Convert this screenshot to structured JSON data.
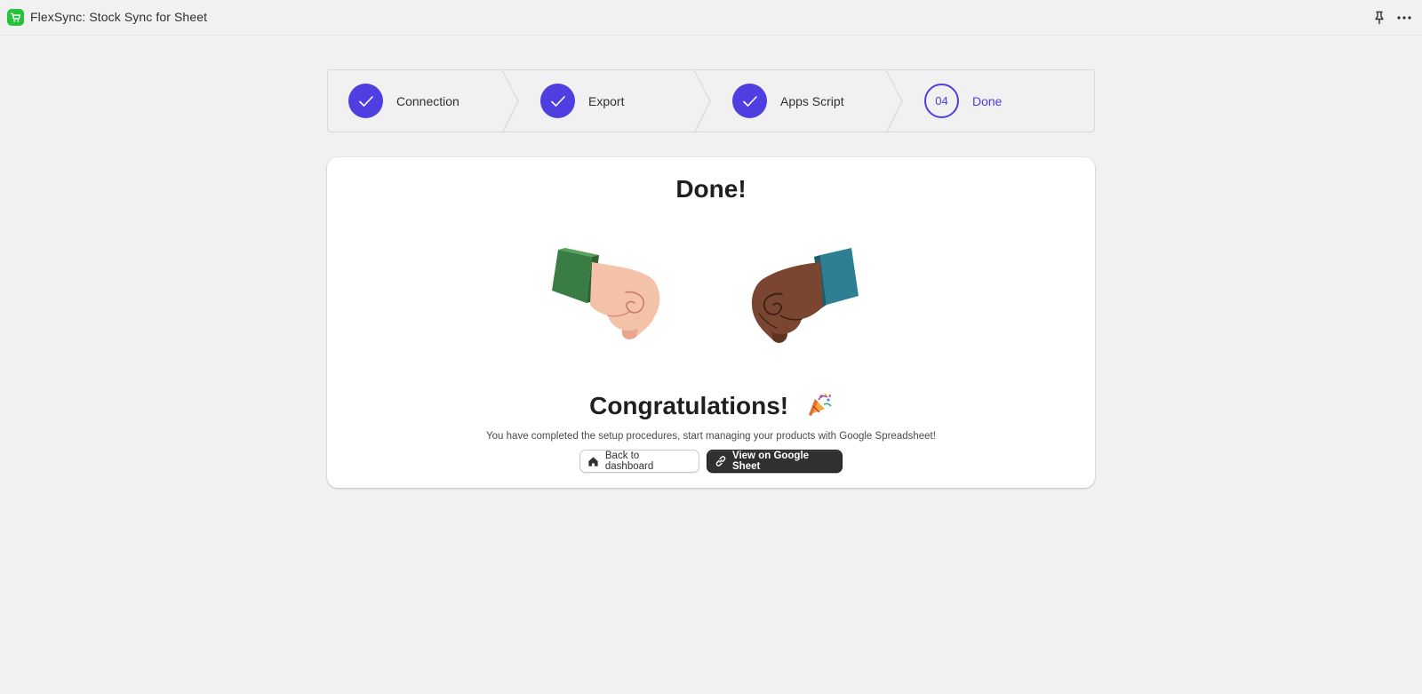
{
  "app": {
    "title": "FlexSync: Stock Sync for Sheet",
    "icon": "shopping-cart-icon",
    "accent": "#24c43a"
  },
  "topbar": {
    "pin_icon": "pin-icon",
    "more_icon": "more-horizontal-icon"
  },
  "stepper": {
    "accent": "#4f3ee0",
    "steps": [
      {
        "label": "Connection",
        "status": "completed",
        "icon": "check-icon"
      },
      {
        "label": "Export",
        "status": "completed",
        "icon": "check-icon"
      },
      {
        "label": "Apps Script",
        "status": "completed",
        "icon": "check-icon"
      },
      {
        "label": "Done",
        "status": "current",
        "number": "04"
      }
    ]
  },
  "main": {
    "title": "Done!",
    "illustration": "fist-bump-illustration",
    "congrats": "Congratulations!",
    "congrats_icon": "party-popper-icon",
    "message": "You have completed the setup procedures, start managing your products with Google Spreadsheet!",
    "buttons": {
      "back": {
        "label": "Back to dashboard",
        "icon": "home-icon"
      },
      "view": {
        "label": "View on Google Sheet",
        "icon": "link-icon"
      }
    }
  }
}
